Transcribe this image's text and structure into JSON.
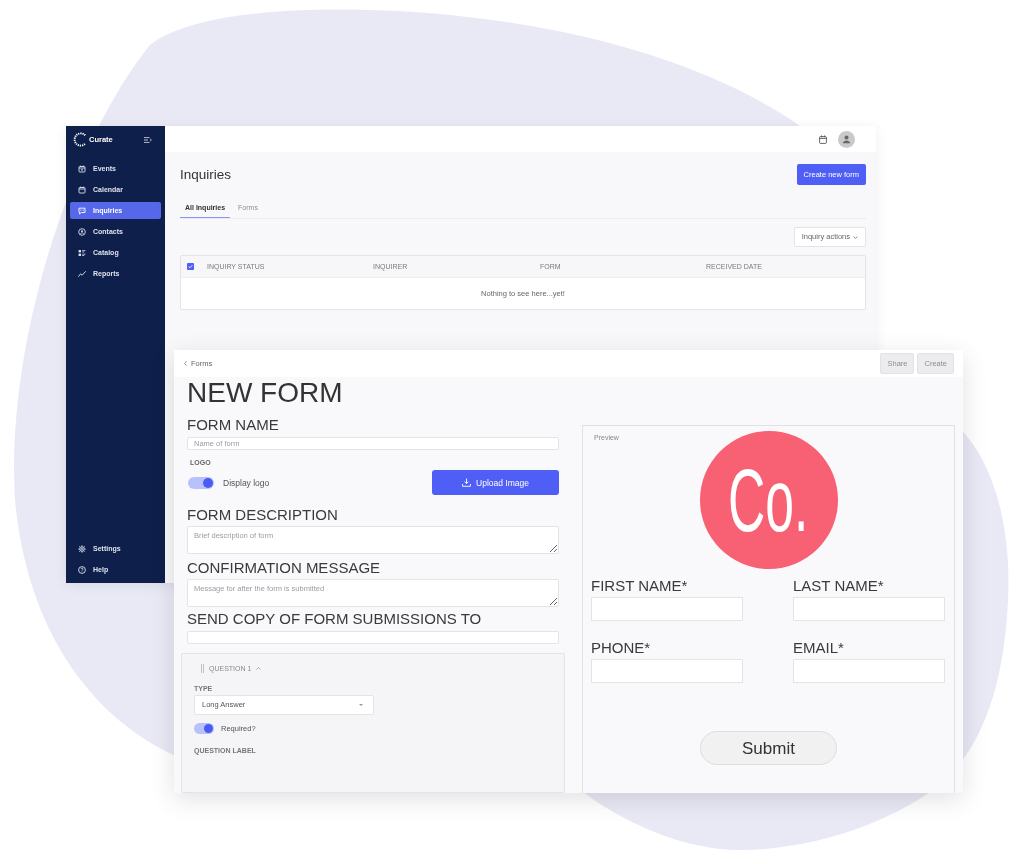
{
  "back_window": {
    "sidebar": {
      "logo": "Curate",
      "items": [
        {
          "label": "Events",
          "selected": false
        },
        {
          "label": "Calendar",
          "selected": false
        },
        {
          "label": "Inquiries",
          "selected": true
        },
        {
          "label": "Contacts",
          "selected": false
        },
        {
          "label": "Catalog",
          "selected": false
        },
        {
          "label": "Reports",
          "selected": false
        }
      ],
      "footer_items": [
        {
          "label": "Settings"
        },
        {
          "label": "Help"
        }
      ]
    },
    "page_title": "Inquiries",
    "create_button": "Create new form",
    "tabs": [
      {
        "label": "All Inquiries",
        "selected": true
      },
      {
        "label": "Forms",
        "selected": false
      }
    ],
    "actions_button": "Inquiry actions",
    "table": {
      "select_all": {
        "checked": true
      },
      "columns": [
        "INQUIRY STATUS",
        "INQUIRER",
        "FORM",
        "RECEIVED DATE"
      ],
      "empty_message": "Nothing to see here...yet!"
    }
  },
  "front_window": {
    "back_link": "Forms",
    "buttons": [
      {
        "label": "Share",
        "disabled": true
      },
      {
        "label": "Create",
        "disabled": true
      }
    ],
    "title": "NEW FORM",
    "sections": [
      {
        "kind": "input",
        "label": "FORM NAME",
        "placeholder": "Name of form"
      },
      {
        "kind": "logo",
        "label": "LOGO",
        "toggle": {
          "label": "Display logo",
          "on": true
        },
        "button": "Upload Image"
      },
      {
        "kind": "textarea",
        "label": "FORM DESCRIPTION",
        "placeholder": "Brief description of form"
      },
      {
        "kind": "textarea",
        "label": "CONFIRMATION MESSAGE",
        "placeholder": "Message for after the form is submitted"
      },
      {
        "kind": "input",
        "label": "SEND COPY OF FORM SUBMISSIONS TO"
      }
    ],
    "question": {
      "title": "QUESTION 1",
      "expanded": true,
      "type_label": "TYPE",
      "type_value": "Long Answer",
      "required": {
        "label": "Required?",
        "on": true
      },
      "label_heading": "QUESTION LABEL"
    },
    "preview": {
      "label": "Preview",
      "logo_text": "Co.",
      "fields": [
        {
          "label": "FIRST NAME*"
        },
        {
          "label": "LAST NAME*"
        },
        {
          "label": "PHONE*"
        },
        {
          "label": "EMAIL*"
        }
      ],
      "submit": "Submit"
    }
  }
}
